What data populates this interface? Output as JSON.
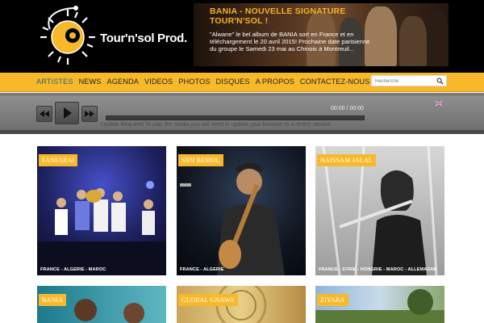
{
  "header": {
    "logo_text": "Tour'n'sol Prod.",
    "banner_title": "BANIA - NOUVELLE SIGNATURE TOUR'N'SOL !",
    "banner_text": "\"Alwane\" le bel album de BANIA sort en France et en téléchargement le 20 avril 2015! Prochaine date parisienne du groupe le Samedi 23 mai au Chinois à Montreuil..."
  },
  "nav": {
    "items": [
      "ARTISTES",
      "NEWS",
      "AGENDA",
      "VIDEOS",
      "PHOTOS",
      "DISQUES",
      "A PROPOS",
      "CONTACTEZ-NOUS"
    ],
    "active": "ARTISTES",
    "search_placeholder": "Recherche"
  },
  "player": {
    "time": "00:00 / 00:00",
    "update_message": "Update Required To play the media you will need to update your browser to a recent version."
  },
  "artists": [
    {
      "name": "FANFARAI",
      "countries": "FRANCE - ALGERIE - MAROC"
    },
    {
      "name": "SIDI BEMOL",
      "countries": "FRANCE - ALGERIE"
    },
    {
      "name": "NAISSAM JALAL",
      "countries": "FRANCE - SYRIE - HONGRIE - MAROC - ALLEMAGNE"
    },
    {
      "name": "BANIA",
      "countries": ""
    },
    {
      "name": "GLOBAL GNAWA",
      "countries": ""
    },
    {
      "name": "ZIYARA",
      "countries": ""
    }
  ],
  "colors": {
    "accent": "#f7b92a",
    "header_bg": "#000000",
    "nav_active": "#2f5f78",
    "banner_title": "#f5b324"
  },
  "icons": {
    "logo": "sun-music-logo-icon",
    "search": "search-icon",
    "prev": "rewind-icon",
    "play": "play-icon",
    "next": "fast-forward-icon",
    "flag": "uk-flag-icon"
  }
}
